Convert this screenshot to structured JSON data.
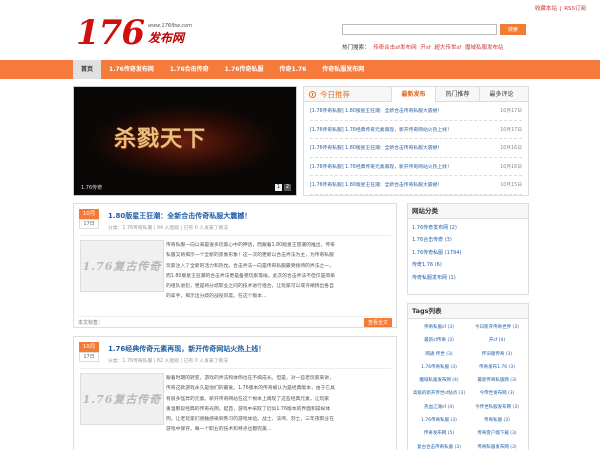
{
  "header": {
    "top_links": [
      "收藏本站",
      "RSS订阅"
    ],
    "top_sep": "|",
    "logo_number": "176",
    "logo_url": "www.176fbw.com",
    "logo_text": "发布网",
    "search_button": "搜索",
    "hot_label": "热门搜索：",
    "hot_links": [
      "传奇合击sf发布网",
      "开sf",
      "超大传世sf",
      "魔域私服发布站"
    ]
  },
  "nav": {
    "items": [
      "首页",
      "1.76传奇发布网",
      "1.76合击传奇",
      "1.76传奇私服",
      "传奇1.76",
      "传奇私服发布网"
    ]
  },
  "slider": {
    "image_title": "杀戮天下",
    "caption": "1.76传奇",
    "dots": [
      "1",
      "2"
    ]
  },
  "tabs": {
    "title": "今日推荐",
    "tab_labels": [
      "最新发布",
      "热门推荐",
      "最多评论"
    ],
    "rows": [
      {
        "text": "[1.76传奇私服] 1.80版星王狂潮：全新合击传奇私服大震撼！",
        "date": "10月17日"
      },
      {
        "text": "[1.76传奇私服] 1.76经典传奇元素再现，新开传奇网站火热上线！",
        "date": "10月17日"
      },
      {
        "text": "[1.76传奇私服] 1.80版星王狂潮：全新合击传奇私服大震撼！",
        "date": "10月16日"
      },
      {
        "text": "[1.76传奇私服] 1.76经典传奇元素再现，新开传奇网站火热上线！",
        "date": "10月16日"
      },
      {
        "text": "[1.76传奇私服] 1.80版星王狂潮：全新合击传奇私服大震撼！",
        "date": "10月15日"
      }
    ]
  },
  "posts": [
    {
      "month": "10月",
      "day": "17日",
      "title": "1.80版星王狂潮：全新合击传奇私服大震撼！",
      "meta": "分类：1.76传奇私服 | 94 人围观 | 已有 0 人发表了看法",
      "thumb_text": "1.76复古传奇",
      "body": [
        "传奇私服一向以来是很多玩家心中的神话，而跟着1.80版星王怒潮的推出，传奇",
        "私服又将揭示一个全新的景象形象！这一次的更新以合击弄法为主，为传奇私服",
        "玩家注入了全新的活力和热忱。合击弄法一向是传奇私服最受接待的弄法之一，",
        "而1.80版星王狂潮的合击弄法更是备受玩家等候。此次的合击弄法不但仅是简单",
        "的组队进犯，更是将分歧职业之间的技术进行组合，让玩家可以或许阐扬出各自",
        "的拿手，揭示出分歧的战役风度。在这个版本..."
      ],
      "tags_label": "本文标签：",
      "more_button": "查看全文"
    },
    {
      "month": "10月",
      "day": "17日",
      "title": "1.76经典传奇元素再现，新开传奇网站火热上线！",
      "meta": "分类：1.76传奇私服 | 82 人围观 | 已有 0 人发表了看法",
      "thumb_text": "1.76复古传奇",
      "body": [
        "跟着时期的转变，游戏的弄法和体例也在不竭成长。但是，对一些老玩家来讲，",
        "传奇这款游戏永久是他们的最爱。1.76版本的传奇被认为是经典版本，由于它具",
        "有很多怪异的元素。新开传奇网站在这个根本上再现了这些经典元素，让玩家",
        "重温那段经典的传奇光阴。起首，游戏中采取了近似1.76版本的界面和操纵体",
        "例，让老玩家们感触感染到熟习的游戏体验。战士、法师、羽士，三年夜职业在",
        "游戏中保存，每一个职业的技术和特点也都完美..."
      ]
    }
  ],
  "sidebar": {
    "category_title": "网站分类",
    "categories": [
      "1.76传奇发布网 (2)",
      "1.76合击传奇 (3)",
      "1.76传奇私服 (1794)",
      "传奇1.76 (6)",
      "传奇私服发布网 (1)"
    ],
    "tags_title": "Tags列表",
    "tags": [
      "传奇私服sf (3)",
      "今日新开传奇世界 (3)",
      "最新sf传奇 (3)",
      "开sf (4)",
      "网通 传世 (3)",
      "怀旧版传奇 (3)",
      "1.76传奇私服 (3)",
      "传奇发布1.76 (3)",
      "魔域私服发布网 (4)",
      "最新传奇私服网 (3)",
      "高级的新开传世sf站点 (3)",
      "今传世发布网 (3)",
      "热血江湖sf (4)",
      "今传世私服发布网 (3)",
      "1.76传奇私服 (3)",
      "传奇私服 (3)",
      "传奇发布网 (5)",
      "传奇客户端下载 (3)",
      "复古合击传奇私服 (3)",
      "传奇私服发布网 (3)"
    ]
  }
}
